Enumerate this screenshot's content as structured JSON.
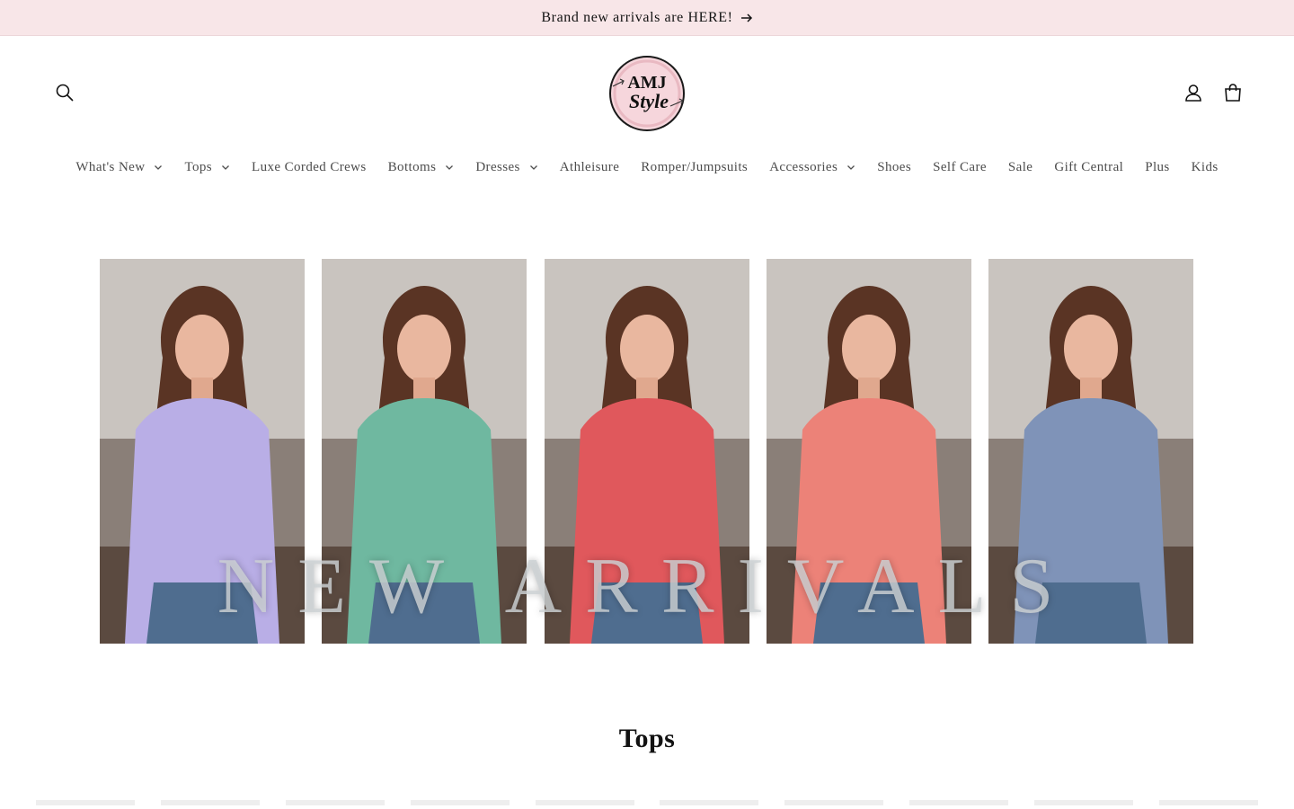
{
  "announcement": {
    "text": "Brand new arrivals are HERE!",
    "arrow_icon": "arrow-right-icon"
  },
  "header": {
    "logo": {
      "line1": "AMJ",
      "line2": "Style"
    },
    "icons": {
      "search": "search-icon",
      "account": "user-icon",
      "cart": "bag-icon"
    }
  },
  "nav": {
    "items": [
      {
        "label": "What's New",
        "dropdown": true
      },
      {
        "label": "Tops",
        "dropdown": true
      },
      {
        "label": "Luxe Corded Crews",
        "dropdown": false
      },
      {
        "label": "Bottoms",
        "dropdown": true
      },
      {
        "label": "Dresses",
        "dropdown": true
      },
      {
        "label": "Athleisure",
        "dropdown": false
      },
      {
        "label": "Romper/Jumpsuits",
        "dropdown": false
      },
      {
        "label": "Accessories",
        "dropdown": true
      },
      {
        "label": "Shoes",
        "dropdown": false
      },
      {
        "label": "Self Care",
        "dropdown": false
      },
      {
        "label": "Sale",
        "dropdown": false
      },
      {
        "label": "Gift Central",
        "dropdown": false
      },
      {
        "label": "Plus",
        "dropdown": false
      },
      {
        "label": "Kids",
        "dropdown": false
      }
    ]
  },
  "banner": {
    "overlay_text": "NEW ARRIVALS",
    "photos": [
      {
        "top_color": "#b9aee6"
      },
      {
        "top_color": "#6fb8a0"
      },
      {
        "top_color": "#e0585c"
      },
      {
        "top_color": "#ec8278"
      },
      {
        "top_color": "#7f93b8"
      }
    ]
  },
  "section": {
    "title": "Tops"
  },
  "colors": {
    "announcement_bg": "#f8e6e8",
    "nav_text": "#4d4d4d"
  }
}
